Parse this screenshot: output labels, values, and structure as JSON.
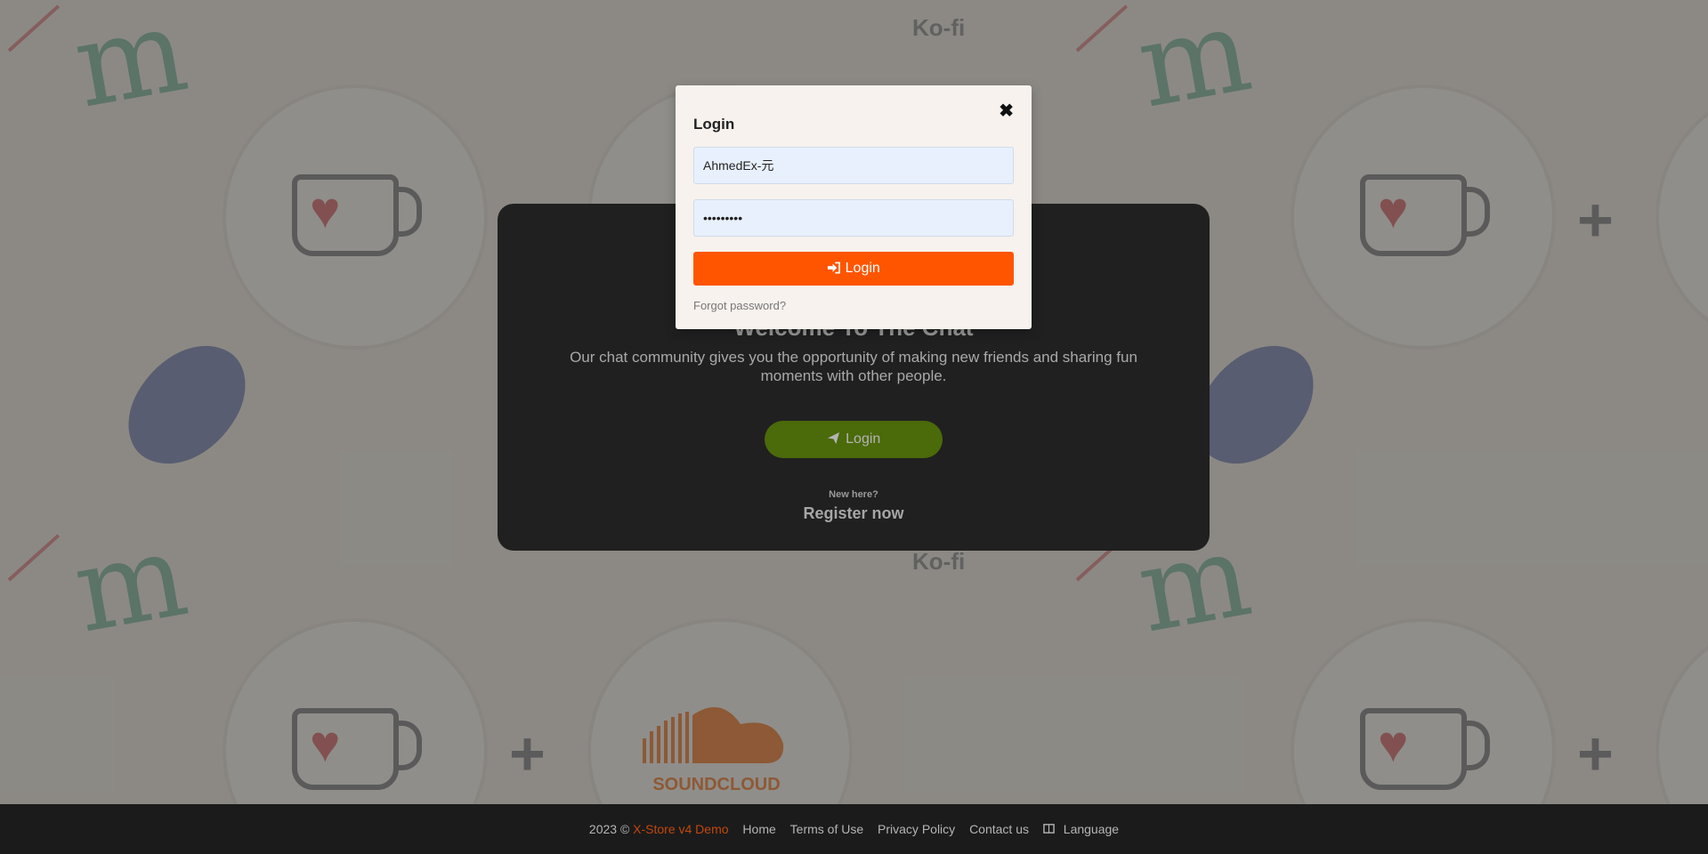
{
  "background": {
    "kofi_label": "Ko-fi",
    "soundcloud_label": "SOUNDCLOUD"
  },
  "welcome": {
    "title": "Welcome To The Chat",
    "description": "Our chat community gives you the opportunity of making new friends and sharing fun moments with other people.",
    "login_button": "Login",
    "login_icon": "paper-plane-icon",
    "new_here": "New here?",
    "register": "Register now"
  },
  "modal": {
    "title": "Login",
    "close_icon": "close-icon",
    "username_value": "AhmedEx-元",
    "password_value": "•••••••••",
    "login_button": "Login",
    "login_icon": "sign-in-icon",
    "forgot_password": "Forgot password?"
  },
  "footer": {
    "copyright": "2023 ©",
    "brand": "X-Store v4 Demo",
    "links": [
      "Home",
      "Terms of Use",
      "Privacy Policy",
      "Contact us",
      "Language"
    ],
    "language_icon": "language-icon"
  },
  "colors": {
    "accent": "#ff5500",
    "welcome_button": "#4b6a0a",
    "footer_bg": "#1b1b1b",
    "card_bg": "#202020",
    "input_bg": "#e8f0fe"
  }
}
